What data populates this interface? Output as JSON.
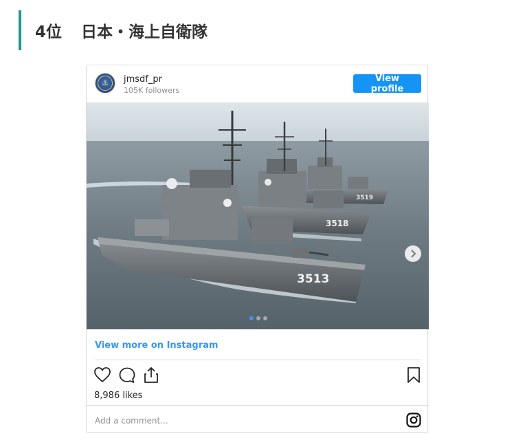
{
  "heading": {
    "rank": "4位",
    "title": "日本・海上自衛隊",
    "accent_color": "#1a9a8b"
  },
  "embed": {
    "username": "jmsdf_pr",
    "followers": "105K followers",
    "view_profile_label": "View profile",
    "view_profile_color": "#1694f6",
    "photo": {
      "hull_numbers": [
        "3513",
        "3518",
        "3519"
      ],
      "carousel_total": 3,
      "carousel_active": 1
    },
    "view_more_label": "View more on Instagram",
    "actions": [
      "heart-icon",
      "comment-icon",
      "share-icon",
      "bookmark-icon"
    ],
    "likes": "8,986 likes",
    "comment_placeholder": "Add a comment...",
    "link_color": "#3897f0"
  }
}
